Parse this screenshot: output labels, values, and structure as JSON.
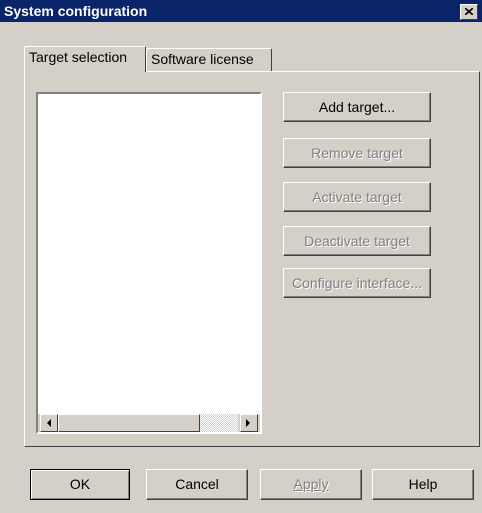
{
  "window": {
    "title": "System configuration",
    "close_icon": "close-icon"
  },
  "tabs": [
    {
      "label": "Target selection",
      "active": true
    },
    {
      "label": "Software license",
      "active": false
    }
  ],
  "target_list": {
    "items": []
  },
  "actions": {
    "add": "Add target...",
    "remove": "Remove target",
    "activate": "Activate target",
    "deactivate": "Deactivate target",
    "configure": "Configure interface..."
  },
  "footer": {
    "ok": "OK",
    "cancel": "Cancel",
    "apply": "Apply",
    "help": "Help"
  }
}
